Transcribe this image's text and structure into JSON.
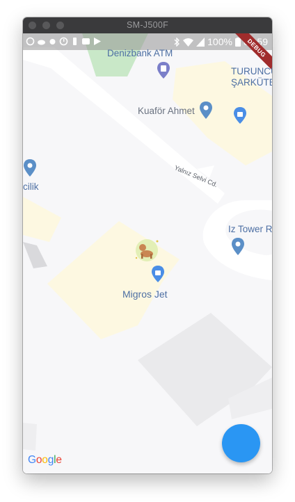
{
  "window": {
    "title": "SM-J500F"
  },
  "statusbar": {
    "battery": "100%",
    "time": "01:59"
  },
  "debug_banner": "DEBUG",
  "map": {
    "places": {
      "denizbank": "Denizbank ATM",
      "turuncu": "TURUNCU",
      "sarkuteri": "ŞARKÜTE",
      "kuafor": "Kuaför Ahmet",
      "street": "Yalnız Selvi Cd.",
      "cilik": "cilik",
      "iztower": "Iz Tower R",
      "migros": "Migros Jet"
    },
    "google_logo": [
      "G",
      "o",
      "o",
      "g",
      "l",
      "e"
    ]
  },
  "colors": {
    "accent": "#2a96f3",
    "park": "#c9e8c8",
    "block": "#fdf8e1",
    "road": "#ffffff",
    "pin": "#5b8fc7"
  }
}
